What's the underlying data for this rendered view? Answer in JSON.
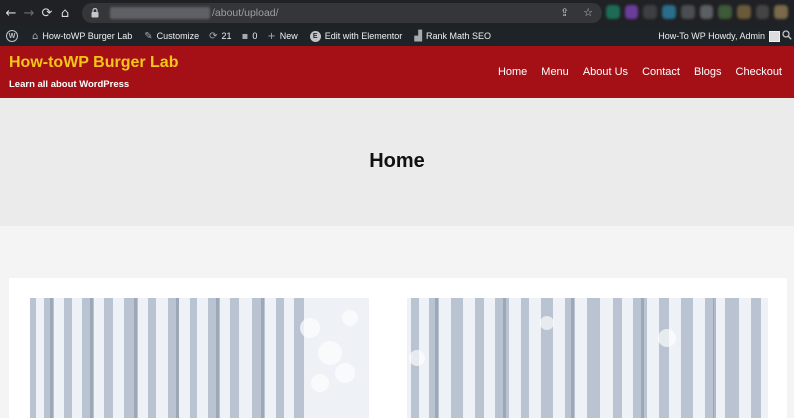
{
  "browser": {
    "url_path": "/about/upload/"
  },
  "admin_bar": {
    "site_name": "How-toWP Burger Lab",
    "customize": "Customize",
    "updates_count": "21",
    "comments_count": "0",
    "new_label": "New",
    "elementor_label": "Edit with Elementor",
    "rankmath_label": "Rank Math SEO",
    "greeting": "How-To WP Howdy, Admin"
  },
  "site": {
    "title": "How-toWP Burger Lab",
    "tagline": "Learn all about WordPress",
    "nav": [
      "Home",
      "Menu",
      "About Us",
      "Contact",
      "Blogs",
      "Checkout"
    ],
    "brand_color": "#a51016",
    "title_color": "#f5c518"
  },
  "page": {
    "title": "Home"
  }
}
